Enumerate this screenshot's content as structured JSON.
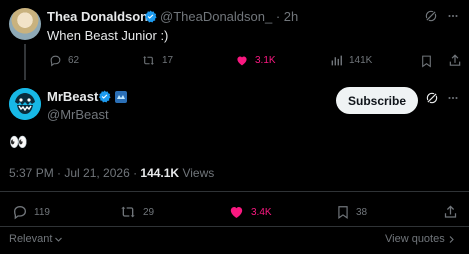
{
  "reply": {
    "author_name": "Thea Donaldson",
    "handle": "@TheaDonaldson_",
    "time": "· 2h",
    "text": "When Beast Junior :)",
    "replies": "62",
    "reposts": "17",
    "likes": "3.1K",
    "views": "141K"
  },
  "post": {
    "author_name": "MrBeast",
    "handle": "@MrBeast",
    "subscribe_label": "Subscribe",
    "text": "👀",
    "timestamp": "5:37 PM · Jul 21, 2026 · ",
    "views_count": "144.1K",
    "views_label": " Views",
    "replies": "119",
    "reposts": "29",
    "likes": "3.4K",
    "bookmarks": "38"
  },
  "footer": {
    "sort_label": "Relevant",
    "view_quotes_label": "View quotes"
  },
  "colors": {
    "background": "#000000",
    "text": "#e7e9ea",
    "muted": "#71767b",
    "like": "#f91880",
    "verified": "#1d9bf0",
    "divider": "#2f3336"
  },
  "icons": [
    "verified-badge-icon",
    "grok-icon",
    "more-icon",
    "reply-icon",
    "repost-icon",
    "like-icon",
    "views-icon",
    "bookmark-icon",
    "share-icon",
    "affiliate-badge-icon",
    "chevron-down-icon"
  ]
}
